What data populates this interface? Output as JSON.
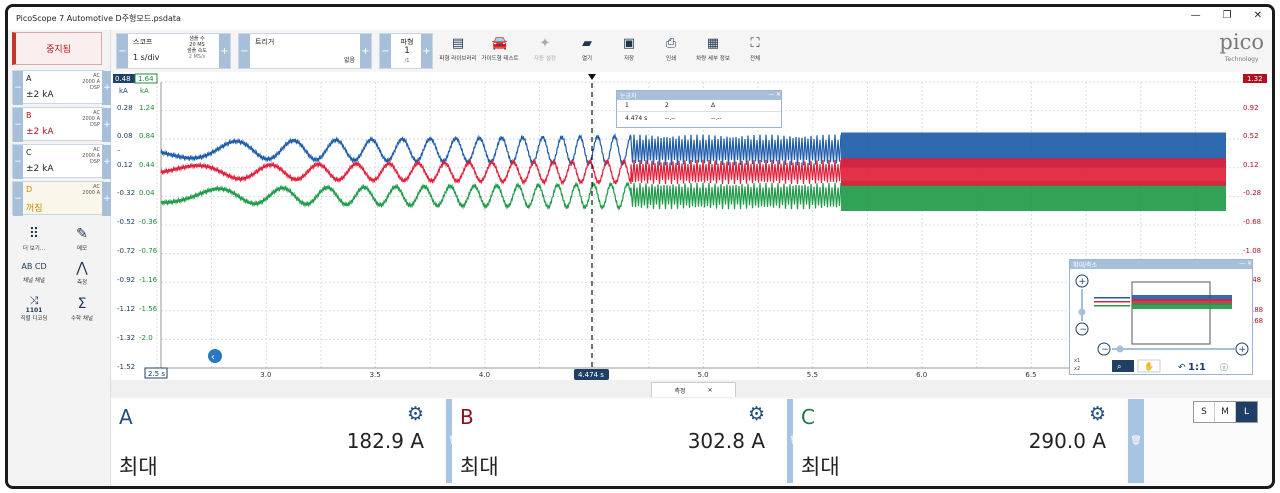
{
  "window": {
    "title": "PicoScope 7 Automotive D주형모드.psdata"
  },
  "left": {
    "stop_label": "중지됨",
    "channels": [
      {
        "name": "A",
        "range": "±2 kA",
        "coupling": "AC",
        "limit": "2000 A",
        "dsp": "DSP",
        "color": "#1f3f66"
      },
      {
        "name": "B",
        "range": "±2 kA",
        "coupling": "AC",
        "limit": "2000 A",
        "dsp": "DSP",
        "color": "#b01020"
      },
      {
        "name": "C",
        "range": "±2 kA",
        "coupling": "AC",
        "limit": "2000 A",
        "dsp": "DSP",
        "color": "#1f3f66"
      },
      {
        "name": "D",
        "range": "꺼짐",
        "coupling": "AC",
        "limit": "2000 A",
        "dsp": "",
        "color": "#c98a00"
      }
    ],
    "tools": {
      "more": "더 보기...",
      "memo": "메모",
      "ref": "채널 채널",
      "measure": "측정",
      "serial": "직렬 디코딩",
      "math": "수학 채널",
      "ab": "AB CD",
      "bits": "1101"
    }
  },
  "toolbar": {
    "scope_label": "스코프",
    "timebase": "1 s/div",
    "samples_label": "샘플 수",
    "samples": "20 MS",
    "rate_label": "샘플 속도",
    "rate": "2 MS/s",
    "trigger_label": "트리거",
    "trigger_mode": "없음",
    "wave_label": "파형",
    "wave_num": "1",
    "wave_total": "/1",
    "buttons": [
      "파형 라이브러리",
      "가이드형 테스트",
      "자동 설정",
      "열기",
      "저장",
      "인쇄",
      "차량 세부 정보",
      "전체"
    ],
    "brand": "pico",
    "brand_sub": "Technology"
  },
  "scope": {
    "left_axis": {
      "units": [
        "kA",
        "kA"
      ],
      "tops": [
        "0.48",
        "1.64"
      ],
      "a_ticks": [
        "0.28",
        "0.08",
        "–",
        "0.12",
        "-0.32",
        "-0.52",
        "-0.72",
        "-0.92",
        "-1.12",
        "-1.32",
        "-1.52"
      ],
      "b_ticks": [
        "1.24",
        "0.84",
        "0.44",
        "0.04",
        "-0.36",
        "-0.76",
        "-1.16",
        "-1.56",
        "-2.0"
      ]
    },
    "right_axis": {
      "top": "1.32",
      "ticks": [
        "0.92",
        "0.52",
        "0.12",
        "-0.28",
        "-0.68",
        "-1.08",
        "-1.48"
      ],
      "extra": [
        ".88",
        ".68"
      ]
    },
    "x_axis": {
      "start": "2.5 s",
      "ticks": [
        "3.0",
        "3.5",
        "4.0",
        "4.5",
        "5.0",
        "5.5",
        "6.0",
        "6.5"
      ],
      "cursor_label": "4.474 s"
    },
    "ruler": {
      "title": "눈금자",
      "col1": "1",
      "col2": "2",
      "col3": "Δ",
      "v1": "4.474 s",
      "v2": "--.--",
      "v3": "--.--"
    },
    "zoom": {
      "title": "확대/축소",
      "ratio": "1:1",
      "x1": "x1",
      "x2": "x2"
    }
  },
  "measurements": {
    "tab_label": "측정",
    "cards": [
      {
        "channel": "A",
        "value": "182.9 A",
        "func": "최대",
        "color": "#1f4f82"
      },
      {
        "channel": "B",
        "value": "302.8 A",
        "func": "최대",
        "color": "#8b1020"
      },
      {
        "channel": "C",
        "value": "290.0 A",
        "func": "최대",
        "color": "#1e7a3a"
      }
    ],
    "sizes": [
      "S",
      "M",
      "L"
    ]
  },
  "colors": {
    "blue": "#1d5ca8",
    "red": "#e0203a",
    "green": "#1f9a48",
    "accent": "#a7bfd9"
  }
}
